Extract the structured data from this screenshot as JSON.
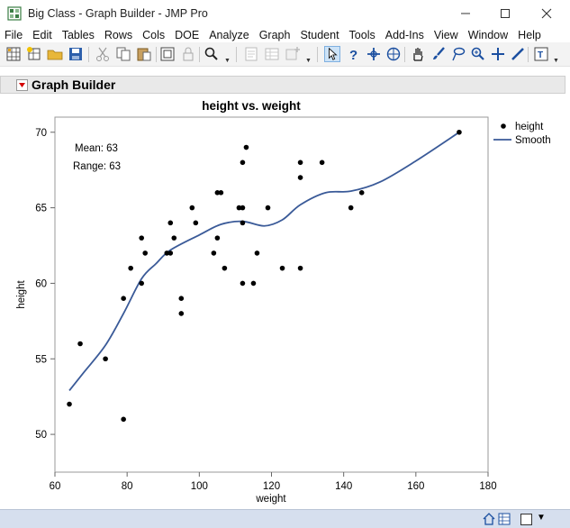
{
  "window": {
    "title": "Big Class - Graph Builder - JMP Pro"
  },
  "menu": [
    "File",
    "Edit",
    "Tables",
    "Rows",
    "Cols",
    "DOE",
    "Analyze",
    "Graph",
    "Student",
    "Tools",
    "Add-Ins",
    "View",
    "Window",
    "Help"
  ],
  "panel": {
    "title": "Graph Builder"
  },
  "chart_data": {
    "type": "scatter",
    "title": "height vs. weight",
    "xlabel": "weight",
    "ylabel": "height",
    "xlim": [
      60,
      180
    ],
    "ylim": [
      47.5,
      71
    ],
    "xticks": [
      60,
      80,
      100,
      120,
      140,
      160,
      180
    ],
    "yticks": [
      50,
      55,
      60,
      65,
      70
    ],
    "grid": false,
    "legend": {
      "position": "right",
      "entries": [
        {
          "label": "height",
          "kind": "marker",
          "color": "#000000"
        },
        {
          "label": "Smooth",
          "kind": "line",
          "color": "#3a5a98"
        }
      ]
    },
    "annotations": [
      "Mean: 63",
      "Range: 63"
    ],
    "series": [
      {
        "name": "height",
        "points": [
          [
            64,
            52
          ],
          [
            67,
            56
          ],
          [
            74,
            55
          ],
          [
            79,
            51
          ],
          [
            79,
            59
          ],
          [
            81,
            61
          ],
          [
            84,
            60
          ],
          [
            84,
            63
          ],
          [
            85,
            62
          ],
          [
            91,
            62
          ],
          [
            92,
            62
          ],
          [
            92,
            64
          ],
          [
            93,
            63
          ],
          [
            95,
            59
          ],
          [
            95,
            58
          ],
          [
            98,
            65
          ],
          [
            99,
            64
          ],
          [
            104,
            62
          ],
          [
            105,
            63
          ],
          [
            105,
            66
          ],
          [
            106,
            66
          ],
          [
            107,
            61
          ],
          [
            111,
            65
          ],
          [
            112,
            65
          ],
          [
            112,
            68
          ],
          [
            112,
            64
          ],
          [
            112,
            60
          ],
          [
            113,
            69
          ],
          [
            115,
            60
          ],
          [
            116,
            62
          ],
          [
            119,
            65
          ],
          [
            123,
            61
          ],
          [
            128,
            68
          ],
          [
            128,
            67
          ],
          [
            128,
            61
          ],
          [
            134,
            68
          ],
          [
            142,
            65
          ],
          [
            145,
            66
          ],
          [
            172,
            70
          ]
        ]
      },
      {
        "name": "Smooth",
        "points": [
          [
            64,
            52.9
          ],
          [
            68,
            54.1
          ],
          [
            74,
            55.9
          ],
          [
            79,
            58.0
          ],
          [
            84,
            60.3
          ],
          [
            88,
            61.3
          ],
          [
            92,
            62.2
          ],
          [
            100,
            63.2
          ],
          [
            106,
            63.9
          ],
          [
            112,
            64.1
          ],
          [
            118,
            63.8
          ],
          [
            123,
            64.2
          ],
          [
            128,
            65.2
          ],
          [
            135,
            66.0
          ],
          [
            142,
            66.1
          ],
          [
            150,
            66.7
          ],
          [
            160,
            68.1
          ],
          [
            172,
            70.0
          ]
        ]
      }
    ]
  }
}
